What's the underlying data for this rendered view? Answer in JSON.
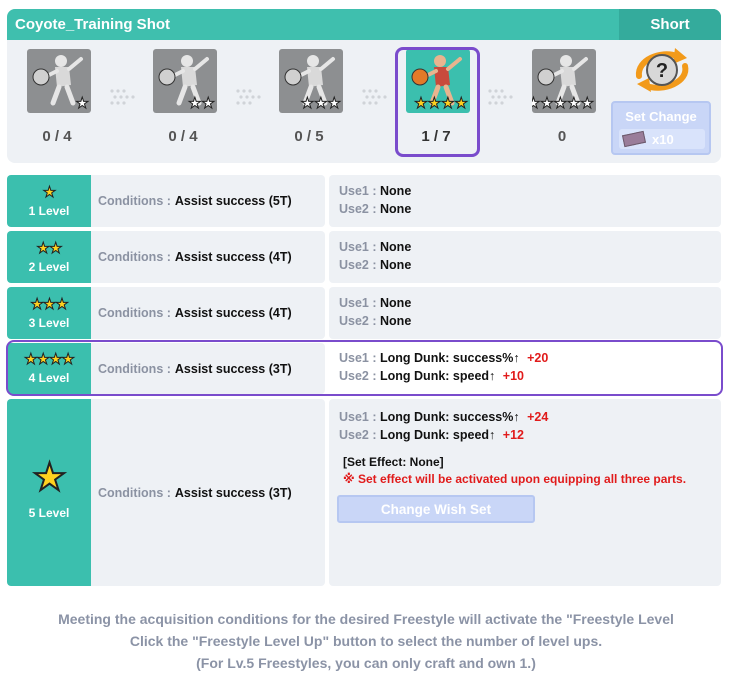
{
  "header": {
    "title": "Coyote_Training Shot",
    "tag": "Short"
  },
  "parts": [
    {
      "count": "0 / 4",
      "stars": 1,
      "active": false
    },
    {
      "count": "0 / 4",
      "stars": 2,
      "active": false
    },
    {
      "count": "0 / 5",
      "stars": 3,
      "active": false
    },
    {
      "count": "1 / 7",
      "stars": 4,
      "active": true
    },
    {
      "count": "0",
      "stars": 5,
      "active": false
    }
  ],
  "set_change": {
    "label": "Set Change",
    "cost": "x10"
  },
  "levels": [
    {
      "stars": "★",
      "label": "1 Level",
      "cond_key": "Conditions :",
      "cond_val": "Assist success (5T)",
      "use1_key": "Use1 :",
      "use1_val": "None",
      "use1_up": "",
      "use2_key": "Use2 :",
      "use2_val": "None",
      "use2_up": ""
    },
    {
      "stars": "★★",
      "label": "2 Level",
      "cond_key": "Conditions :",
      "cond_val": "Assist success (4T)",
      "use1_key": "Use1 :",
      "use1_val": "None",
      "use1_up": "",
      "use2_key": "Use2 :",
      "use2_val": "None",
      "use2_up": ""
    },
    {
      "stars": "★★★",
      "label": "3 Level",
      "cond_key": "Conditions :",
      "cond_val": "Assist success (4T)",
      "use1_key": "Use1 :",
      "use1_val": "None",
      "use1_up": "",
      "use2_key": "Use2 :",
      "use2_val": "None",
      "use2_up": ""
    },
    {
      "stars": "★★★★",
      "label": "4 Level",
      "cond_key": "Conditions :",
      "cond_val": "Assist success (3T)",
      "use1_key": "Use1 :",
      "use1_val": "Long Dunk: success%↑",
      "use1_up": "+20",
      "use2_key": "Use2 :",
      "use2_val": "Long Dunk: speed↑",
      "use2_up": "+10"
    },
    {
      "stars": "★",
      "label": "5 Level",
      "cond_key": "Conditions :",
      "cond_val": "Assist success (3T)",
      "use1_key": "Use1 :",
      "use1_val": "Long Dunk: success%↑",
      "use1_up": "+24",
      "use2_key": "Use2 :",
      "use2_val": "Long Dunk: speed↑",
      "use2_up": "+12",
      "set_effect_title": "[Set Effect: None]",
      "set_effect_note": "※ Set effect will be activated upon equipping all three parts.",
      "wish_button": "Change Wish Set"
    }
  ],
  "footer": {
    "line1": "Meeting the acquisition conditions for the desired Freestyle will activate the \"Freestyle Level",
    "line2": "Click the \"Freestyle Level Up\" button to select the number of level ups.",
    "line3": "(For Lv.5 Freestyles, you can only craft and own 1.)"
  },
  "colors": {
    "teal": "#3bbfae",
    "selected": "#7a4ccc",
    "up": "#e11b1b",
    "muted": "#8b92a2"
  }
}
